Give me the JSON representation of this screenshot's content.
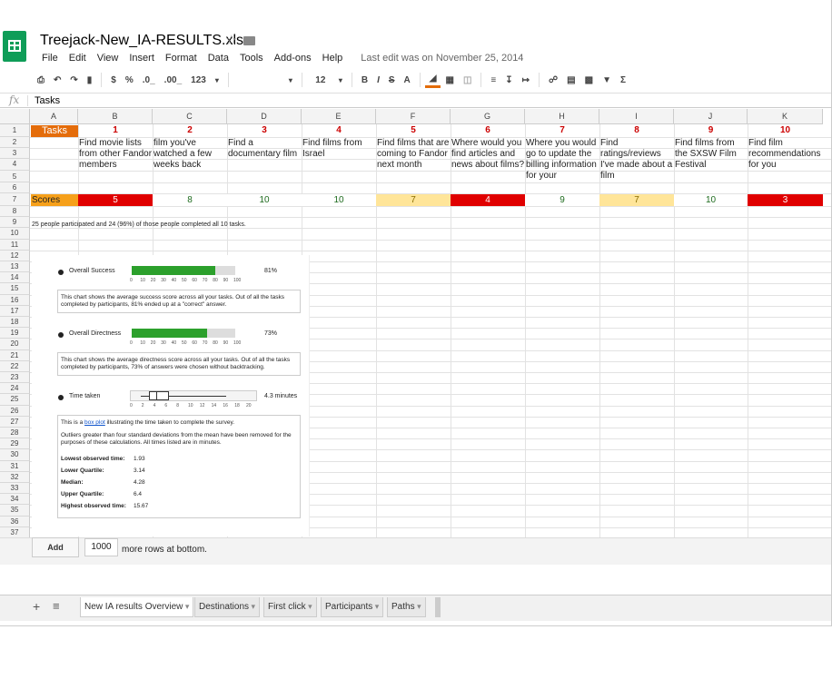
{
  "app": {
    "file_title": "Treejack-New_IA-RESULTS.xls",
    "last_edit": "Last edit was on November 25, 2014"
  },
  "menu": [
    "File",
    "Edit",
    "View",
    "Insert",
    "Format",
    "Data",
    "Tools",
    "Add-ons",
    "Help"
  ],
  "toolbar": {
    "currency": "$",
    "percent": "%",
    "dec_less": ".0_",
    "dec_more": ".00_",
    "format": "123",
    "font_size": "12"
  },
  "formula_bar": {
    "fx": "fx",
    "value": "Tasks"
  },
  "columns": [
    "A",
    "B",
    "C",
    "D",
    "E",
    "F",
    "G",
    "H",
    "I",
    "J",
    "K"
  ],
  "rows": [
    "1",
    "2",
    "3",
    "4",
    "5",
    "6",
    "7",
    "8",
    "9",
    "10",
    "11",
    "12",
    "13",
    "14",
    "15",
    "16",
    "17",
    "18",
    "19",
    "20",
    "21",
    "22",
    "23",
    "24",
    "25",
    "26",
    "27",
    "28",
    "29",
    "30",
    "31",
    "32",
    "33",
    "34",
    "35",
    "36",
    "37"
  ],
  "sheet": {
    "tasks_label": "Tasks",
    "task_numbers": [
      "1",
      "2",
      "3",
      "4",
      "5",
      "6",
      "7",
      "8",
      "9",
      "10"
    ],
    "task_texts": [
      "Find movie lists from other Fandor members",
      "film you've watched a few weeks back",
      "Find a documentary film",
      "Find films from Israel",
      "Find films that are coming to Fandor next month",
      "Where would you find articles and news about films?",
      "Where you would go to update the billing information for your",
      "Find ratings/reviews I've made about a film",
      "Find films from the SXSW Film Festival",
      "Find film recommendations for you"
    ],
    "scores_label": "Scores",
    "scores": [
      "5",
      "8",
      "10",
      "10",
      "7",
      "4",
      "9",
      "7",
      "10",
      "3"
    ],
    "score_colors": [
      "#e00000",
      "#ffffff",
      "#ffffff",
      "#ffffff",
      "#ffe599",
      "#e00000",
      "#ffffff",
      "#ffe599",
      "#ffffff",
      "#e00000"
    ],
    "participation_note": "25 people participated and 24 (96%) of those people completed all 10 tasks."
  },
  "widget": {
    "success_label": "Overall Success",
    "success_value": "81%",
    "success_level": 0.81,
    "success_desc": "This chart shows the average success score across all your tasks. Out of all the tasks completed by participants, 81% ended up at a \"correct\" answer.",
    "directness_label": "Overall Directness",
    "directness_value": "73%",
    "directness_level": 0.73,
    "directness_desc": "This chart shows the average directness score across all your tasks. Out of all the tasks completed by participants, 73% of answers were chosen without backtracking.",
    "pct_ticks": [
      "0",
      "10",
      "20",
      "30",
      "40",
      "50",
      "60",
      "70",
      "80",
      "90",
      "100"
    ],
    "time_label": "Time taken",
    "time_value": "4.3 minutes",
    "time_ticks": [
      "0",
      "2",
      "4",
      "6",
      "8",
      "10",
      "12",
      "14",
      "16",
      "18",
      "20"
    ],
    "box_intro_pre": "This is a ",
    "box_link": "box plot",
    "box_intro_post": " illustrating the time taken to complete the survey.",
    "box_outliers": "Outliers greater than four standard deviations from the mean have been removed for the purposes of these calculations. All times listed are in minutes.",
    "stats": [
      {
        "label": "Lowest observed time:",
        "value": "1.93"
      },
      {
        "label": "Lower Quartile:",
        "value": "3.14"
      },
      {
        "label": "Median:",
        "value": "4.28"
      },
      {
        "label": "Upper Quartile:",
        "value": "6.4"
      },
      {
        "label": "Highest observed time:",
        "value": "15.67"
      }
    ]
  },
  "bottom": {
    "add_label": "Add",
    "rows_value": "1000",
    "rows_text": "more rows at bottom."
  },
  "tabs": [
    "New IA results Overview",
    "Destinations",
    "First click",
    "Participants",
    "Paths"
  ]
}
